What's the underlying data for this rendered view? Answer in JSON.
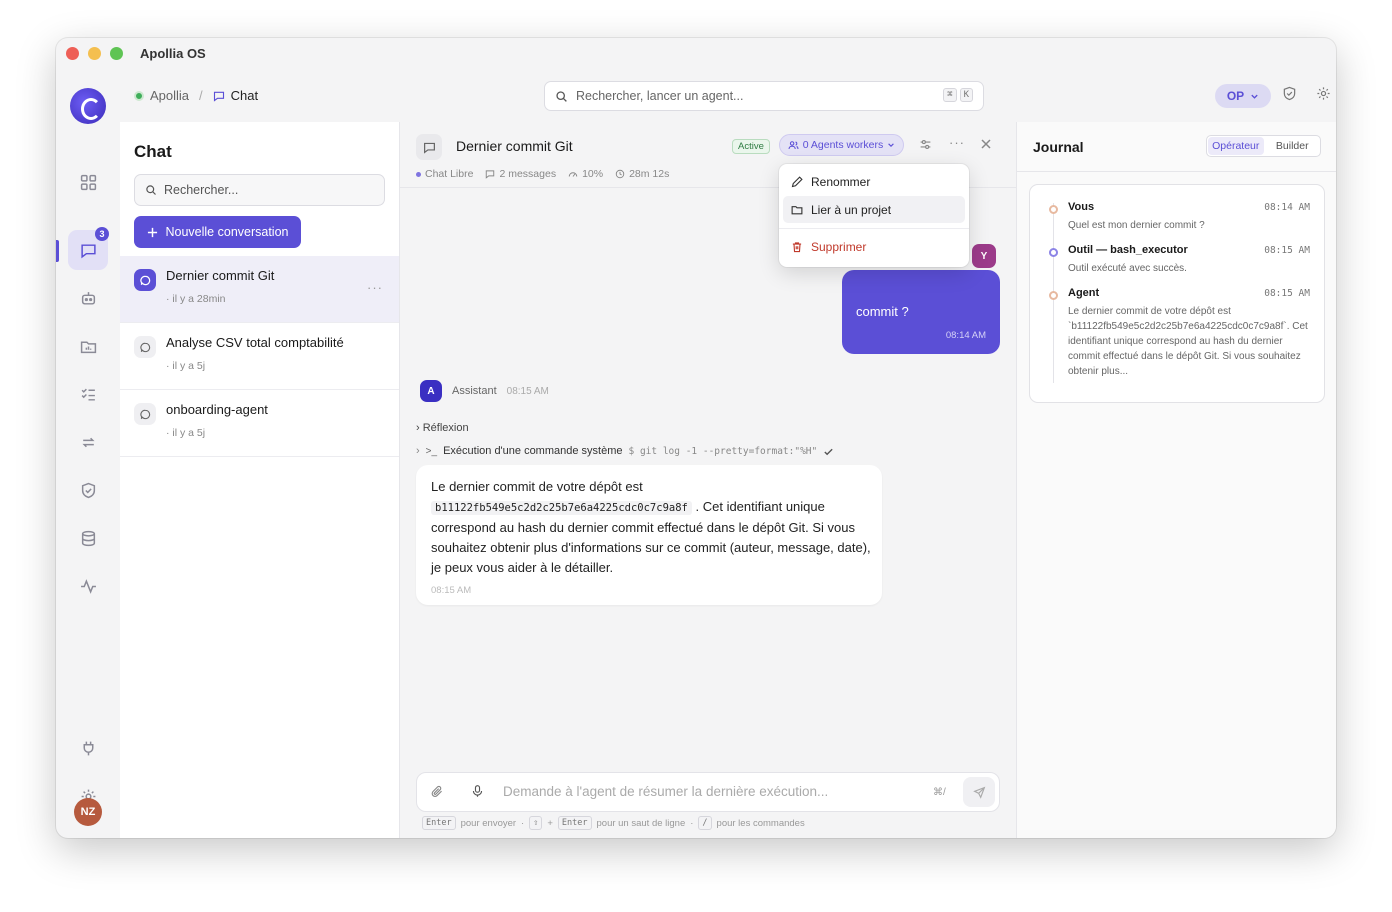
{
  "window": {
    "title": "Apollia OS"
  },
  "rail": {
    "chat_badge": "3",
    "user_initials": "NZ"
  },
  "breadcrumb": {
    "root": "Apollia",
    "separator": "/",
    "current": "Chat"
  },
  "search": {
    "placeholder": "Rechercher, lancer un agent...",
    "kbd1": "⌘",
    "kbd2": "K"
  },
  "topbar": {
    "operator_badge": "OP"
  },
  "conversations": {
    "title": "Chat",
    "search_placeholder": "Rechercher...",
    "new_label": "Nouvelle conversation",
    "items": [
      {
        "title": "Dernier commit Git",
        "time": "· il y a 28min",
        "more": "···"
      },
      {
        "title": "Analyse CSV total comptabilité",
        "time": "· il y a 5j"
      },
      {
        "title": "onboarding-agent",
        "time": "· il y a 5j"
      }
    ]
  },
  "chat": {
    "title": "Dernier commit Git",
    "status": "Active",
    "agents_label": "0 Agents workers",
    "meta": {
      "mode": "Chat Libre",
      "messages": "2 messages",
      "progress": "10%",
      "duration": "28m 12s"
    },
    "user_message": {
      "avatar": "Y",
      "text": "commit ?",
      "time": "08:14 AM"
    },
    "assistant": {
      "avatar": "A",
      "name": "Assistant",
      "time": "08:15 AM",
      "reflection_label": "› Réflexion",
      "exec_label": "Exécution d'une commande système",
      "exec_command": "$ git log -1 --pretty=format:\"%H\"",
      "text_before": "Le dernier commit de votre dépôt est",
      "commit_hash": "b11122fb549e5c2d2c25b7e6a4225cdc0c7c9a8f",
      "text_after": ". Cet identifiant unique correspond au hash du dernier commit effectué dans le dépôt Git. Si vous souhaitez obtenir plus d'informations sur ce commit (auteur, message, date), je peux vous aider à le détailler.",
      "bubble_time": "08:15 AM"
    },
    "composer": {
      "placeholder": "Demande à l'agent de résumer la dernière exécution...",
      "shortcut": "⌘/"
    },
    "hints": {
      "enter": "Enter",
      "send": "pour envoyer",
      "shift": "⇧",
      "plus": "+",
      "enter2": "Enter",
      "newline": "pour un saut de ligne",
      "slash": "/",
      "commands": "pour les commandes",
      "dot": "·"
    }
  },
  "menu": {
    "rename": "Renommer",
    "link": "Lier à un projet",
    "delete": "Supprimer"
  },
  "journal": {
    "title": "Journal",
    "tabs": [
      "Opérateur",
      "Builder"
    ],
    "entries": [
      {
        "who": "Vous",
        "time": "08:14 AM",
        "msg": "Quel est mon dernier commit ?"
      },
      {
        "who": "Outil — bash_executor",
        "time": "08:15 AM",
        "msg": "Outil exécuté avec succès."
      },
      {
        "who": "Agent",
        "time": "08:15 AM",
        "msg": "Le dernier commit de votre dépôt est `b11122fb549e5c2d2c25b7e6a4225cdc0c7c9a8f`. Cet identifiant unique correspond au hash du dernier commit effectué dans le dépôt Git. Si vous souhaitez obtenir plus..."
      }
    ]
  }
}
